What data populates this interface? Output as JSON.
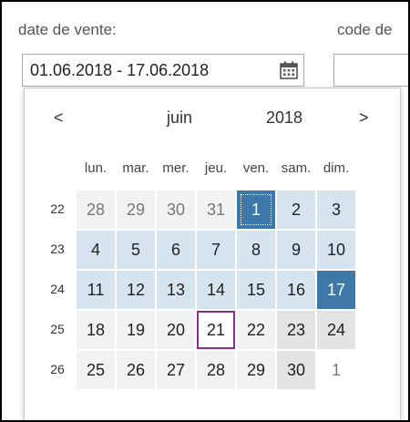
{
  "form": {
    "date_label": "date de vente:",
    "code_label": "code de",
    "date_value": "01.06.2018 - 17.06.2018"
  },
  "calendar": {
    "prev": "<",
    "next": ">",
    "month": "juin",
    "year": "2018",
    "weekdays": [
      "lun.",
      "mar.",
      "mer.",
      "jeu.",
      "ven.",
      "sam.",
      "dim."
    ],
    "weeks": [
      {
        "num": "22",
        "days": [
          {
            "d": "28",
            "s": "other"
          },
          {
            "d": "29",
            "s": "other"
          },
          {
            "d": "30",
            "s": "other"
          },
          {
            "d": "31",
            "s": "other"
          },
          {
            "d": "1",
            "s": "endpoint focused"
          },
          {
            "d": "2",
            "s": "range"
          },
          {
            "d": "3",
            "s": "range"
          }
        ]
      },
      {
        "num": "23",
        "days": [
          {
            "d": "4",
            "s": "range"
          },
          {
            "d": "5",
            "s": "range"
          },
          {
            "d": "6",
            "s": "range"
          },
          {
            "d": "7",
            "s": "range"
          },
          {
            "d": "8",
            "s": "range"
          },
          {
            "d": "9",
            "s": "range"
          },
          {
            "d": "10",
            "s": "range"
          }
        ]
      },
      {
        "num": "24",
        "days": [
          {
            "d": "11",
            "s": "range"
          },
          {
            "d": "12",
            "s": "range"
          },
          {
            "d": "13",
            "s": "range"
          },
          {
            "d": "14",
            "s": "range"
          },
          {
            "d": "15",
            "s": "range"
          },
          {
            "d": "16",
            "s": "range"
          },
          {
            "d": "17",
            "s": "endpoint"
          }
        ]
      },
      {
        "num": "25",
        "days": [
          {
            "d": "18",
            "s": "normal"
          },
          {
            "d": "19",
            "s": "normal"
          },
          {
            "d": "20",
            "s": "normal"
          },
          {
            "d": "21",
            "s": "today"
          },
          {
            "d": "22",
            "s": "normal"
          },
          {
            "d": "23",
            "s": "weekend"
          },
          {
            "d": "24",
            "s": "weekend"
          }
        ]
      },
      {
        "num": "26",
        "days": [
          {
            "d": "25",
            "s": "normal"
          },
          {
            "d": "26",
            "s": "normal"
          },
          {
            "d": "27",
            "s": "normal"
          },
          {
            "d": "28",
            "s": "normal"
          },
          {
            "d": "29",
            "s": "normal"
          },
          {
            "d": "30",
            "s": "weekend"
          },
          {
            "d": "1",
            "s": "other blank"
          }
        ]
      }
    ]
  },
  "colors": {
    "range": "#d6e4ef",
    "endpoint": "#3d78a8",
    "today_border": "#8e2c8d"
  },
  "icons": {
    "calendar_button": "calendar-icon"
  }
}
